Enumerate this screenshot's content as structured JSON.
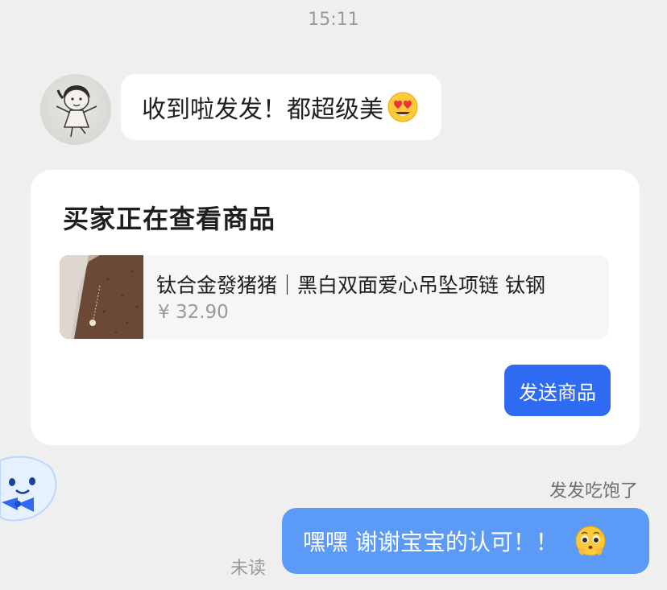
{
  "timestamp": "15:11",
  "incoming_message": {
    "text": "收到啦发发！都超级美",
    "emoji": "heart-eyes-emoji"
  },
  "product_card": {
    "title": "买家正在查看商品",
    "product": {
      "name": "钛合金發猪猪｜黑白双面爱心吊坠项链 钛钢",
      "price": "¥ 32.90"
    },
    "send_button_label": "发送商品",
    "colors": {
      "button": "#2f6bf2"
    }
  },
  "outgoing_message": {
    "sender_label": "发发吃饱了",
    "text": "嘿嘿 谢谢宝宝的认可！！",
    "emoji": "pleading-face-emoji",
    "status": "未读",
    "colors": {
      "bubble": "#5b9bf7"
    }
  }
}
